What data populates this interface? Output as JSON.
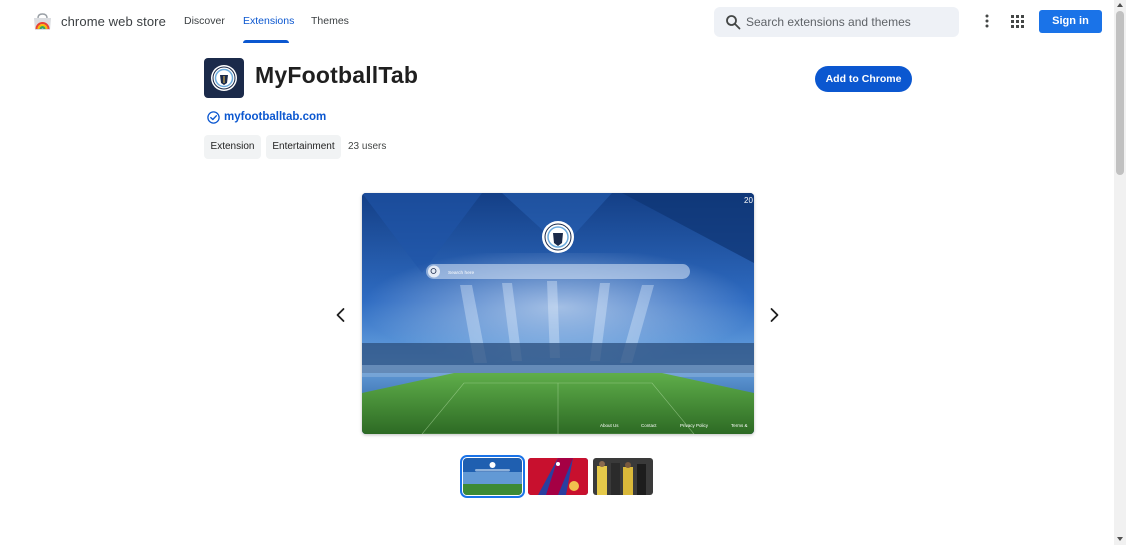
{
  "header": {
    "brand": "chrome web store",
    "tabs": [
      {
        "label": "Discover",
        "active": false
      },
      {
        "label": "Extensions",
        "active": true
      },
      {
        "label": "Themes",
        "active": false
      }
    ],
    "search": {
      "placeholder": "Search extensions and themes",
      "value": ""
    },
    "signin_label": "Sign in",
    "icons": [
      "chrome-web-store-logo",
      "search-icon",
      "more-vert-icon",
      "apps-grid-icon"
    ]
  },
  "extension": {
    "title": "MyFootballTab",
    "add_button": "Add to Chrome",
    "website": "myfootballtab.com",
    "chips": [
      "Extension",
      "Entertainment"
    ],
    "users": "23 users"
  },
  "screenshot": {
    "search_text": "Search here",
    "corner_text": "20",
    "footer_links": [
      "About Us",
      "Contact",
      "Privacy Policy",
      "Terms &"
    ]
  },
  "carousel": {
    "thumbnail_count": 3,
    "selected_index": 0
  },
  "colors": {
    "accent": "#0b57d0",
    "signin": "#1a73e8",
    "chip_bg": "#f1f3f4"
  }
}
